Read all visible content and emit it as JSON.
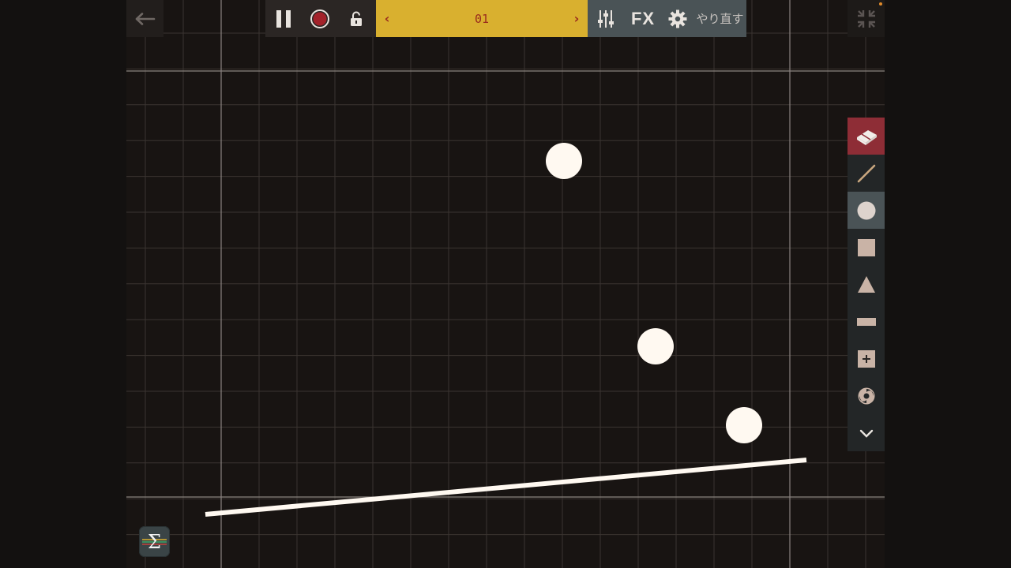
{
  "app": {
    "colors": {
      "background": "#181412",
      "gridline": "#3a3431",
      "boundary": "#8a8380",
      "ball": "#fff9f1",
      "scene_bar": "#d9b02f",
      "scene_text": "#9a2b1d",
      "tools_bar": "#4a5356",
      "eraser_active": "#8e2d36",
      "tool_icon": "#c9b3a6"
    }
  },
  "toolbar": {
    "back_icon": "arrow-left-icon",
    "pause_icon": "pause-icon",
    "record_icon": "record-icon",
    "lock_icon": "unlock-icon",
    "scene_prev": "‹",
    "scene_label": "01",
    "scene_next": "›",
    "mixer_icon": "mixer-sliders-icon",
    "fx_label": "FX",
    "settings_icon": "gear-icon",
    "redo_label": "やり直す",
    "fullscreen_icon": "fullscreen-collapse-icon"
  },
  "palette": {
    "items": [
      {
        "name": "eraser",
        "icon": "eraser-icon",
        "state": "active"
      },
      {
        "name": "line",
        "icon": "line-tool-icon",
        "state": "normal"
      },
      {
        "name": "circle",
        "icon": "circle-tool-icon",
        "state": "selected"
      },
      {
        "name": "square",
        "icon": "square-tool-icon",
        "state": "normal"
      },
      {
        "name": "triangle",
        "icon": "triangle-tool-icon",
        "state": "normal"
      },
      {
        "name": "rectangle",
        "icon": "rectangle-tool-icon",
        "state": "normal"
      },
      {
        "name": "add-block",
        "icon": "plus-block-icon",
        "state": "normal"
      },
      {
        "name": "spinner",
        "icon": "spinner-tool-icon",
        "state": "normal"
      },
      {
        "name": "more",
        "icon": "chevron-down-icon",
        "state": "normal"
      }
    ]
  },
  "canvas": {
    "sigma_label": "Σ",
    "sigma_icon": "sigma-icon",
    "ball_count": 3,
    "line_count": 1
  }
}
